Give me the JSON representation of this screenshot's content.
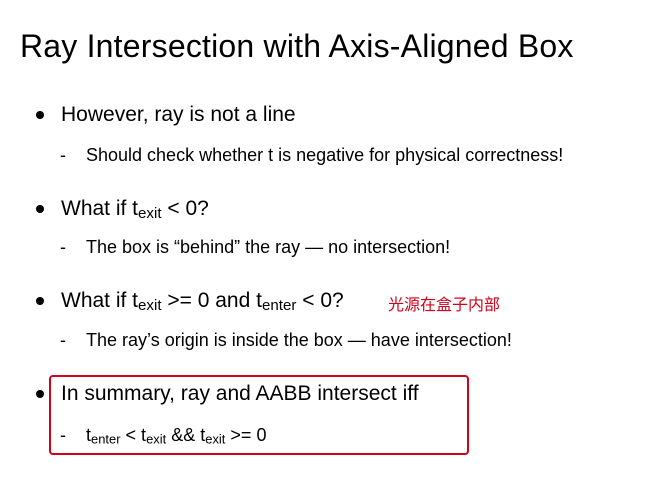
{
  "slide": {
    "title": "Ray Intersection with Axis-Aligned Box",
    "annotation": "光源在盒子内部",
    "colors": {
      "annotation": "#d0021b",
      "highlight_box": "#d0021b",
      "text": "#000000"
    },
    "bullets": [
      {
        "text": "However, ray is not a line",
        "sub": "Should check whether t is negative for physical correctness!"
      },
      {
        "pre": "What if t",
        "sub1": "exit",
        "post": " < 0?",
        "sub": "The box is “behind” the ray — no intersection!"
      },
      {
        "pre": "What if t",
        "sub1": "exit",
        "mid": " >= 0 and t",
        "sub2": "enter",
        "post": " < 0?",
        "sub": "The ray’s origin is inside the box — have intersection!"
      },
      {
        "text": "In summary, ray and AABB intersect iff",
        "formula": {
          "t1": "t",
          "s1": "enter",
          "op1": " < t",
          "s2": "exit",
          "op2": " && t",
          "s3": "exit",
          "op3": " >= 0"
        }
      }
    ],
    "dash": "-"
  }
}
